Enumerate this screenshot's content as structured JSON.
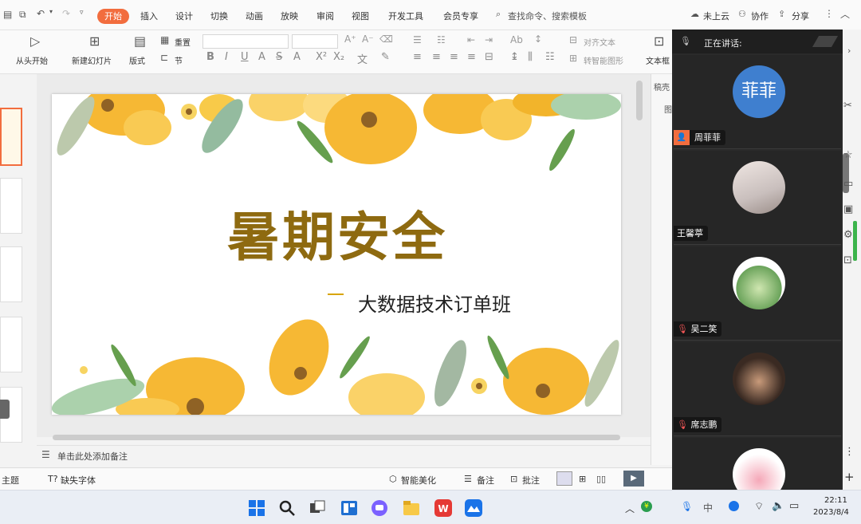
{
  "menu": {
    "tabs": [
      "开始",
      "插入",
      "设计",
      "切换",
      "动画",
      "放映",
      "审阅",
      "视图",
      "开发工具",
      "会员专享"
    ],
    "search": "查找命令、搜索模板",
    "right": [
      "未上云",
      "协作",
      "分享"
    ]
  },
  "ribbon": {
    "from_start": "从头开始",
    "new_slide": "新建幻灯片",
    "layout": "版式",
    "reset": "重置",
    "section": "节",
    "align_text": "对齐文本",
    "smart_art": "转智能图形",
    "textbox": "文本框"
  },
  "slide": {
    "title": "暑期安全",
    "subtitle": "大数据技术订单班"
  },
  "notes_placeholder": "单击此处添加备注",
  "statusbar": {
    "theme": "主题",
    "missing_font": "缺失字体",
    "beautify": "智能美化",
    "notes": "备注",
    "comments": "批注"
  },
  "right_pane": {
    "label1": "稿壳",
    "label2": "图"
  },
  "call": {
    "speaking_label": "正在讲话:",
    "participants": [
      {
        "name": "周菲菲",
        "avatar_text": "菲菲",
        "avatar_color": "#3f7fcf"
      },
      {
        "name": "王馨葶"
      },
      {
        "name": "吴二笑"
      },
      {
        "name": "席志鹏"
      },
      {
        "name": ""
      }
    ]
  },
  "taskbar": {
    "time": "22:11",
    "date": "2023/8/4",
    "ime": "中"
  },
  "colors": {
    "accent": "#f26d3e",
    "title": "#8e6a10",
    "flower": "#f5b21e"
  }
}
